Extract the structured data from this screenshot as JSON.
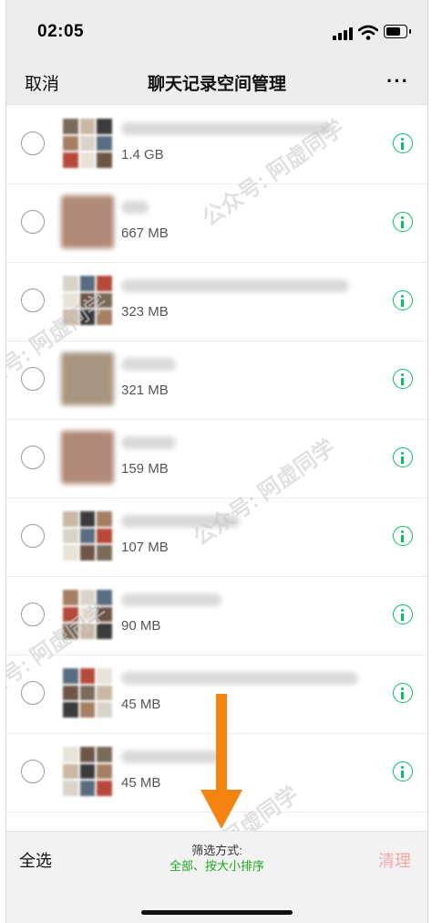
{
  "status": {
    "time": "02:05"
  },
  "nav": {
    "cancel": "取消",
    "title": "聊天记录空间管理",
    "more": "···"
  },
  "items": [
    {
      "size": "1.4 GB",
      "thumb": "grid",
      "name_width": 230
    },
    {
      "size": "667 MB",
      "thumb": "photo",
      "name_width": 30
    },
    {
      "size": "323 MB",
      "thumb": "grid",
      "name_width": 250
    },
    {
      "size": "321 MB",
      "thumb": "photo",
      "name_width": 60
    },
    {
      "size": "159 MB",
      "thumb": "photo",
      "name_width": 60
    },
    {
      "size": "107 MB",
      "thumb": "grid",
      "name_width": 130
    },
    {
      "size": "90 MB",
      "thumb": "grid",
      "name_width": 110
    },
    {
      "size": "45 MB",
      "thumb": "grid",
      "name_width": 260
    },
    {
      "size": "45 MB",
      "thumb": "grid",
      "name_width": 110
    }
  ],
  "bottom": {
    "select_all": "全选",
    "filter_label": "筛选方式:",
    "filter_value": "全部、按大小排序",
    "clear": "清理"
  },
  "watermark": {
    "text": "公众号: 阿虚同学"
  },
  "colors": {
    "accent": "#07c160",
    "arrow": "#f5830f",
    "clear_disabled": "#f5a6a6"
  }
}
